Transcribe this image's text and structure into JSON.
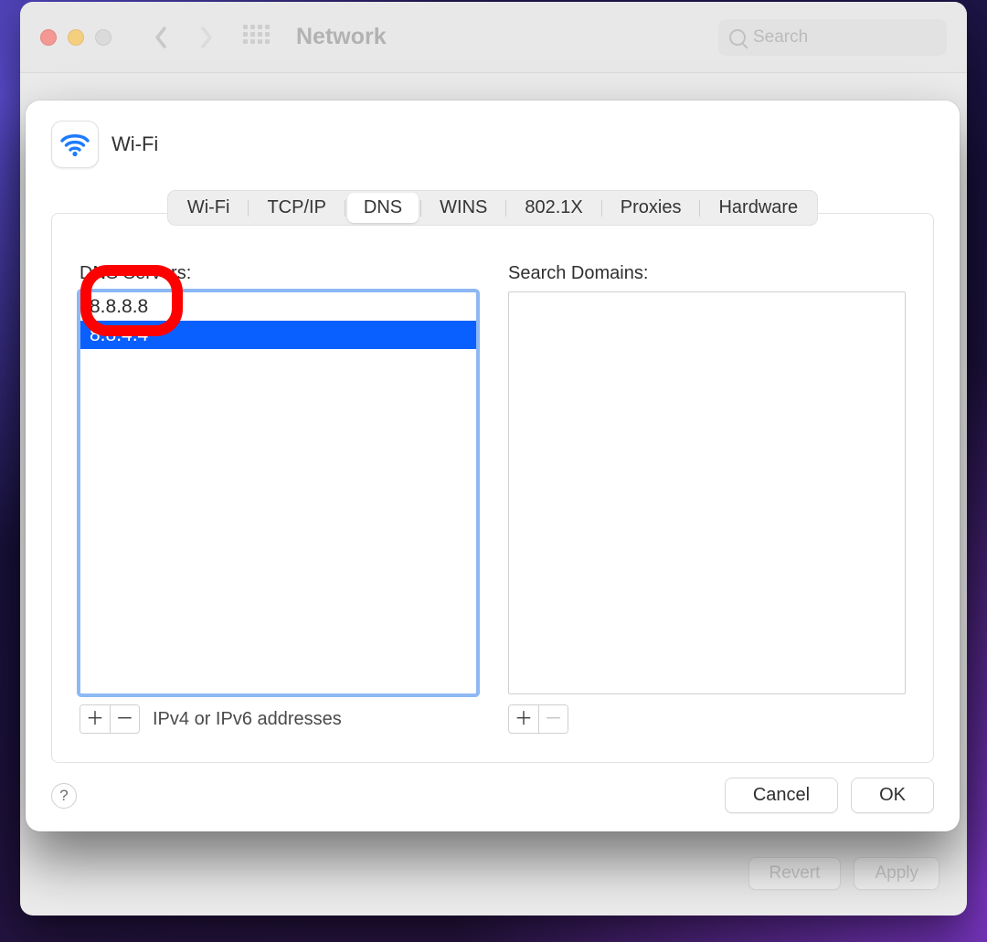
{
  "window": {
    "title": "Network",
    "search_placeholder": "Search"
  },
  "parent_buttons": {
    "revert": "Revert",
    "apply": "Apply"
  },
  "sheet": {
    "title": "Wi-Fi",
    "tabs": [
      "Wi-Fi",
      "TCP/IP",
      "DNS",
      "WINS",
      "802.1X",
      "Proxies",
      "Hardware"
    ],
    "selected_tab_index": 2,
    "dns_label": "DNS Servers:",
    "search_domains_label": "Search Domains:",
    "dns_entries": [
      "8.8.8.8",
      "8.8.4.4"
    ],
    "dns_selected_index": 1,
    "search_domain_entries": [],
    "hint": "IPv4 or IPv6 addresses",
    "cancel": "Cancel",
    "ok": "OK"
  }
}
